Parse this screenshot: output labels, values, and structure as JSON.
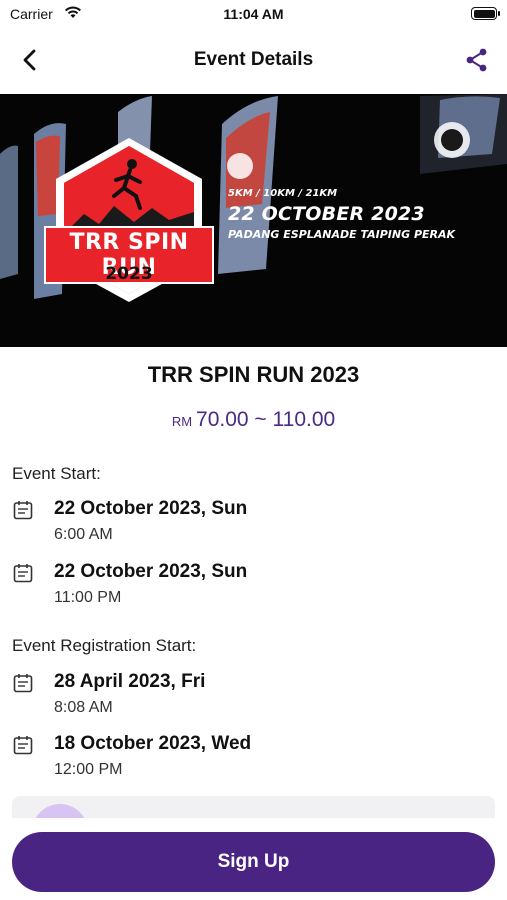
{
  "status_bar": {
    "carrier": "Carrier",
    "time": "11:04 AM"
  },
  "nav": {
    "title": "Event Details",
    "back_icon": "chevron-left-icon",
    "share_icon": "share-icon"
  },
  "banner": {
    "badge_title": "TRR SPIN RUN",
    "badge_year": "2023",
    "distances": "5KM / 10KM / 21KM",
    "date": "22 OCTOBER 2023",
    "venue": "PADANG ESPLANADE TAIPING PERAK"
  },
  "event": {
    "title": "TRR SPIN RUN 2023",
    "currency": "RM",
    "price_range": "70.00 ~ 110.00"
  },
  "event_start": {
    "label": "Event Start:",
    "items": [
      {
        "date": "22 October 2023, Sun",
        "time": "6:00 AM"
      },
      {
        "date": "22 October 2023, Sun",
        "time": "11:00 PM"
      }
    ]
  },
  "registration_start": {
    "label": "Event Registration Start:",
    "items": [
      {
        "date": "28 April 2023, Fri",
        "time": "8:08 AM"
      },
      {
        "date": "18 October 2023, Wed",
        "time": "12:00 PM"
      }
    ]
  },
  "actions": {
    "signup_label": "Sign Up"
  },
  "colors": {
    "accent": "#4a2482",
    "price": "#4b2a86",
    "badge_red": "#e8232a"
  }
}
